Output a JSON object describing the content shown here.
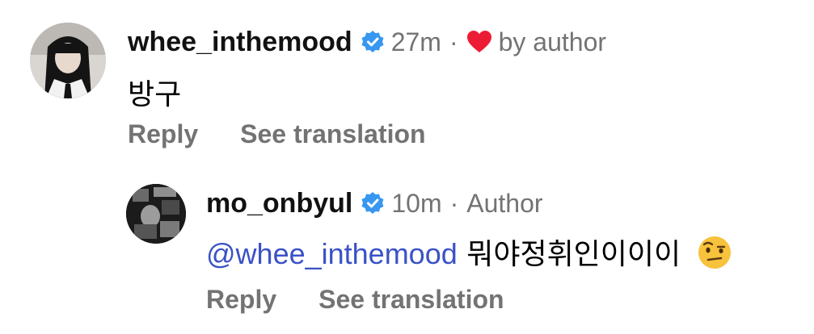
{
  "comment": {
    "username": "whee_inthemood",
    "time": "27m",
    "separator": "·",
    "liked_by_author": "by author",
    "text": "방구",
    "actions": {
      "reply": "Reply",
      "translate": "See translation"
    }
  },
  "reply": {
    "username": "mo_onbyul",
    "time": "10m",
    "separator": "·",
    "role": "Author",
    "mention": "@whee_inthemood",
    "text": "뭐야정휘인이이이",
    "emoji": "face-with-raised-eyebrow-icon",
    "actions": {
      "reply": "Reply",
      "translate": "See translation"
    }
  },
  "colors": {
    "verified": "#3897f0",
    "heart": "#ed1c35",
    "mention": "#3a52c6",
    "meta": "#737373"
  }
}
